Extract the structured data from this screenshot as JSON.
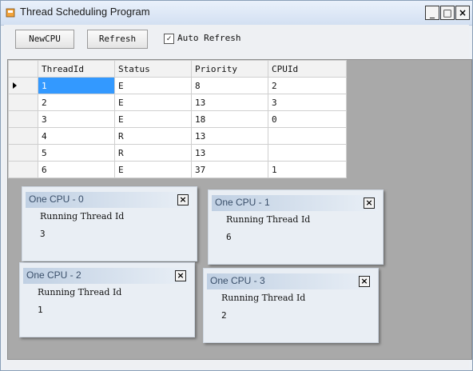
{
  "window": {
    "title": "Thread Scheduling Program",
    "min": "_",
    "max": "□",
    "close": "×"
  },
  "toolbar": {
    "new_cpu": "NewCPU",
    "refresh": "Refresh",
    "auto_refresh": {
      "label": "Auto Refresh",
      "checked": true,
      "mark": "✓"
    }
  },
  "grid": {
    "headers": [
      "ThreadId",
      "Status",
      "Priority",
      "CPUId"
    ],
    "rows": [
      [
        "1",
        "E",
        "8",
        "2"
      ],
      [
        "2",
        "E",
        "13",
        "3"
      ],
      [
        "3",
        "E",
        "18",
        "0"
      ],
      [
        "4",
        "R",
        "13",
        ""
      ],
      [
        "5",
        "R",
        "13",
        ""
      ],
      [
        "6",
        "E",
        "37",
        "1"
      ]
    ],
    "selected_row": 0
  },
  "cpu_windows": [
    {
      "title": "One CPU - 0",
      "label": "Running Thread Id",
      "value": "3",
      "close": "×"
    },
    {
      "title": "One CPU - 1",
      "label": "Running Thread Id",
      "value": "6",
      "close": "×"
    },
    {
      "title": "One CPU - 2",
      "label": "Running Thread Id",
      "value": "1",
      "close": "×"
    },
    {
      "title": "One CPU - 3",
      "label": "Running Thread Id",
      "value": "2",
      "close": "×"
    }
  ]
}
